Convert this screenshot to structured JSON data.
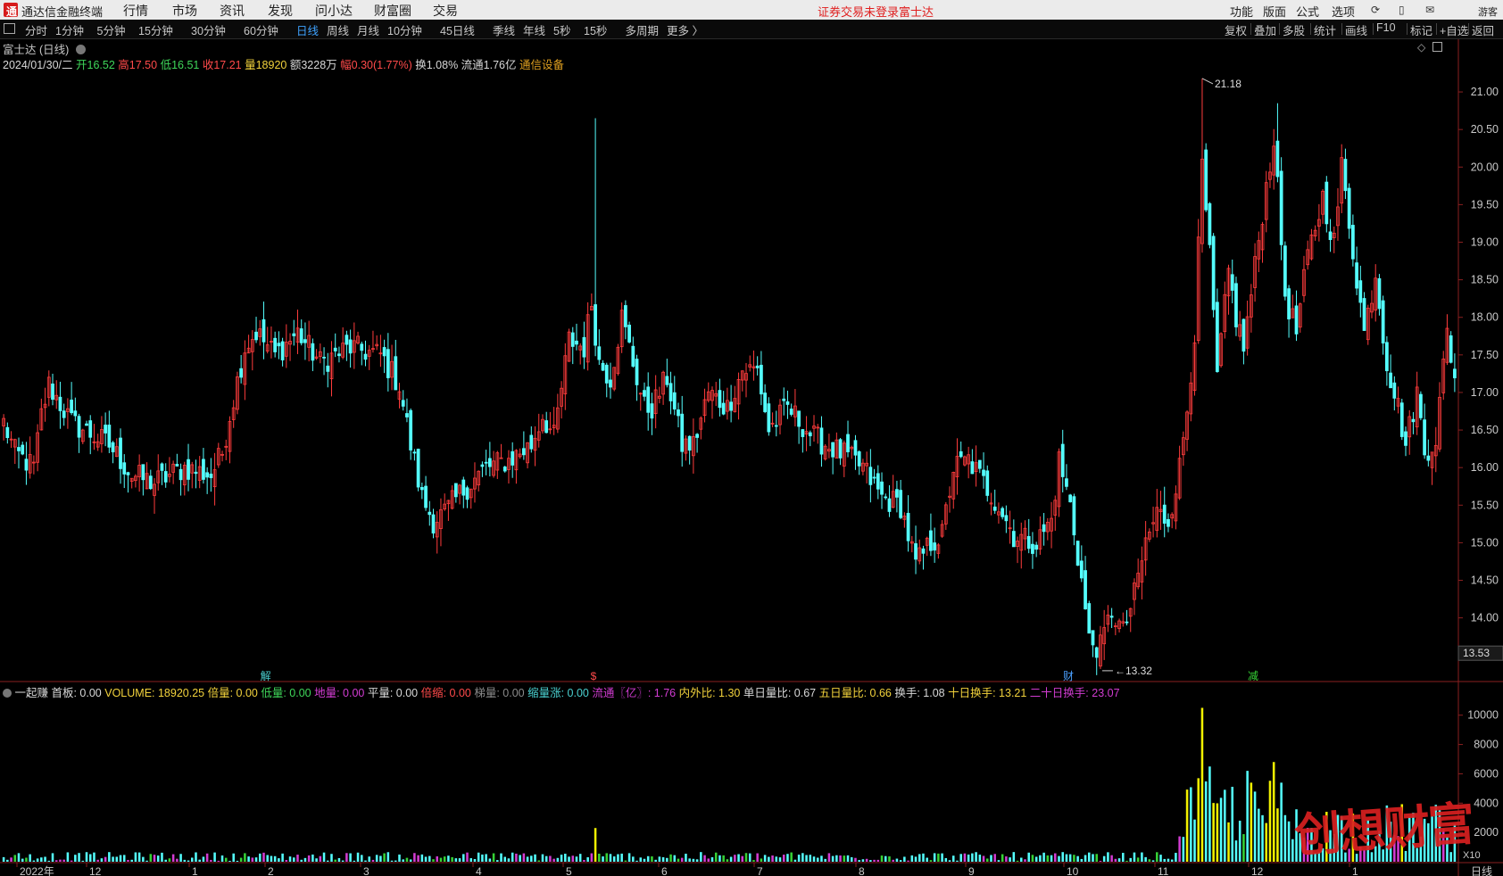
{
  "app": {
    "name": "通达信金融终端",
    "menus": [
      "行情",
      "市场",
      "资讯",
      "发现",
      "问小达",
      "财富圈",
      "交易"
    ],
    "warning": "证券交易未登录",
    "stock_name_top": "富士达",
    "right_menus": [
      "功能",
      "版面",
      "公式",
      "选项"
    ],
    "user": "游客"
  },
  "periods": {
    "items": [
      "分时",
      "1分钟",
      "5分钟",
      "15分钟",
      "30分钟",
      "60分钟",
      "日线",
      "周线",
      "月线",
      "10分钟",
      "45日线",
      "季线",
      "年线",
      "5秒",
      "15秒",
      "多周期",
      "更多 〉"
    ],
    "active": "日线"
  },
  "tools": [
    "复权",
    "叠加",
    "多股",
    "统计",
    "画线",
    "F10",
    "标记",
    "+自选",
    "返回"
  ],
  "info": {
    "title": "富士达 (日线)",
    "date": "2024/01/30/二",
    "open_label": "开16.52",
    "high_label": "高17.50",
    "low_label": "低16.51",
    "close_label": "收17.21",
    "vol_label": "量18920",
    "amount_label": "额3228万",
    "range_label": "幅0.30(1.77%)",
    "turnover_label": "换1.08%",
    "float_label": "流通1.76亿",
    "sector": "通信设备"
  },
  "volume_header": {
    "prefix": "一起赚",
    "items": [
      {
        "text": "首板: 0.00",
        "color": "#d8d8d8"
      },
      {
        "text": "VOLUME: 18920.25",
        "color": "#f2d23c"
      },
      {
        "text": "倍量: 0.00",
        "color": "#f2d23c"
      },
      {
        "text": "低量: 0.00",
        "color": "#3fd75a"
      },
      {
        "text": "地量: 0.00",
        "color": "#d23cd2"
      },
      {
        "text": "平量: 0.00",
        "color": "#d8d8d8"
      },
      {
        "text": "倍缩: 0.00",
        "color": "#ff4a4a"
      },
      {
        "text": "梯量: 0.00",
        "color": "#8a8a8a"
      },
      {
        "text": "缩量涨: 0.00",
        "color": "#4ad0d0"
      },
      {
        "text": "流通〖亿〗: 1.76",
        "color": "#d23cd2"
      },
      {
        "text": "内外比: 1.30",
        "color": "#f2d23c"
      },
      {
        "text": "单日量比: 0.67",
        "color": "#d8d8d8"
      },
      {
        "text": "五日量比: 0.66",
        "color": "#f2d23c"
      },
      {
        "text": "换手: 1.08",
        "color": "#d8d8d8"
      },
      {
        "text": "十日换手: 13.21",
        "color": "#f2d23c"
      },
      {
        "text": "二十日换手: 23.07",
        "color": "#d23cd2"
      }
    ]
  },
  "markers": [
    {
      "text": "解",
      "color": "#4ad0d0",
      "bar": 70
    },
    {
      "text": "$",
      "color": "#ff4a4a",
      "bar": 157
    },
    {
      "text": "财",
      "color": "#4aa0ff",
      "bar": 283
    },
    {
      "text": "减",
      "color": "#36d336",
      "bar": 332
    }
  ],
  "colors": {
    "up": "#ff3c3c",
    "down": "#54ffff",
    "vol_hi": "#f2f200",
    "vol_mid": "#36d336",
    "vol_low": "#d23cd2",
    "axis": "#c8c8c8",
    "border": "#8a2020"
  },
  "chart_data": {
    "type": "candlestick",
    "price_axis": {
      "ticks": [
        13.5,
        14.0,
        14.5,
        15.0,
        15.5,
        16.0,
        16.5,
        17.0,
        17.5,
        18.0,
        18.5,
        19.0,
        19.5,
        20.0,
        20.5,
        21.0
      ],
      "range": [
        13.2,
        21.25
      ]
    },
    "volume_axis": {
      "ticks": [
        2000,
        4000,
        6000,
        8000,
        10000
      ],
      "range": [
        0,
        11200
      ],
      "unit_label": "X10"
    },
    "x_labels": [
      "2022年",
      "12",
      "1",
      "2",
      "3",
      "4",
      "5",
      "6",
      "7",
      "8",
      "9",
      "10",
      "11",
      "12",
      "1"
    ],
    "period_label": "日线",
    "last_price_label": "13.53",
    "max_annotation": "21.18",
    "min_annotation": "13.32",
    "waypoints": [
      [
        0,
        16.6
      ],
      [
        3,
        16.2
      ],
      [
        8,
        16.0
      ],
      [
        10,
        16.7
      ],
      [
        12,
        17.1
      ],
      [
        18,
        16.6
      ],
      [
        28,
        16.3
      ],
      [
        34,
        15.9
      ],
      [
        40,
        15.8
      ],
      [
        48,
        16.0
      ],
      [
        55,
        15.9
      ],
      [
        58,
        16.2
      ],
      [
        60,
        16.7
      ],
      [
        64,
        17.6
      ],
      [
        67,
        17.8
      ],
      [
        72,
        17.5
      ],
      [
        78,
        17.8
      ],
      [
        84,
        17.4
      ],
      [
        92,
        17.6
      ],
      [
        100,
        17.5
      ],
      [
        105,
        17.1
      ],
      [
        108,
        16.3
      ],
      [
        111,
        15.6
      ],
      [
        114,
        15.3
      ],
      [
        117,
        15.4
      ],
      [
        122,
        15.7
      ],
      [
        128,
        16.0
      ],
      [
        134,
        16.1
      ],
      [
        140,
        16.3
      ],
      [
        143,
        16.7
      ],
      [
        146,
        16.4
      ],
      [
        150,
        17.7
      ],
      [
        154,
        17.6
      ],
      [
        156,
        18.2
      ],
      [
        158,
        17.4
      ],
      [
        161,
        17.2
      ],
      [
        164,
        18.0
      ],
      [
        167,
        17.4
      ],
      [
        170,
        16.8
      ],
      [
        172,
        16.8
      ],
      [
        176,
        17.2
      ],
      [
        180,
        16.3
      ],
      [
        183,
        16.3
      ],
      [
        187,
        17.0
      ],
      [
        192,
        16.8
      ],
      [
        196,
        17.3
      ],
      [
        200,
        17.3
      ],
      [
        203,
        16.5
      ],
      [
        208,
        16.8
      ],
      [
        215,
        16.4
      ],
      [
        222,
        16.2
      ],
      [
        228,
        16.0
      ],
      [
        233,
        15.6
      ],
      [
        238,
        15.5
      ],
      [
        242,
        14.7
      ],
      [
        246,
        15.0
      ],
      [
        249,
        15.1
      ],
      [
        252,
        16.0
      ],
      [
        256,
        16.1
      ],
      [
        260,
        15.8
      ],
      [
        264,
        15.5
      ],
      [
        268,
        15.1
      ],
      [
        274,
        15.0
      ],
      [
        278,
        15.3
      ],
      [
        280,
        16.1
      ],
      [
        283,
        15.5
      ],
      [
        286,
        14.5
      ],
      [
        288,
        13.7
      ],
      [
        291,
        13.6
      ],
      [
        294,
        14.1
      ],
      [
        297,
        13.8
      ],
      [
        300,
        14.3
      ],
      [
        303,
        15.0
      ],
      [
        306,
        15.4
      ],
      [
        309,
        15.3
      ],
      [
        312,
        16.0
      ],
      [
        314,
        16.8
      ],
      [
        316,
        17.8
      ],
      [
        318,
        20.0
      ],
      [
        320,
        18.8
      ],
      [
        322,
        17.2
      ],
      [
        325,
        18.6
      ],
      [
        327,
        18.0
      ],
      [
        329,
        17.6
      ],
      [
        331,
        18.3
      ],
      [
        334,
        19.4
      ],
      [
        337,
        20.4
      ],
      [
        340,
        18.3
      ],
      [
        343,
        17.8
      ],
      [
        346,
        18.8
      ],
      [
        350,
        19.6
      ],
      [
        353,
        19.0
      ],
      [
        355,
        20.0
      ],
      [
        358,
        18.9
      ],
      [
        361,
        17.8
      ],
      [
        364,
        18.6
      ],
      [
        367,
        17.4
      ],
      [
        370,
        16.8
      ],
      [
        372,
        16.3
      ],
      [
        375,
        17.0
      ],
      [
        377,
        16.2
      ],
      [
        380,
        16.4
      ],
      [
        383,
        17.8
      ],
      [
        385,
        17.2
      ]
    ],
    "bar_count": 386
  }
}
